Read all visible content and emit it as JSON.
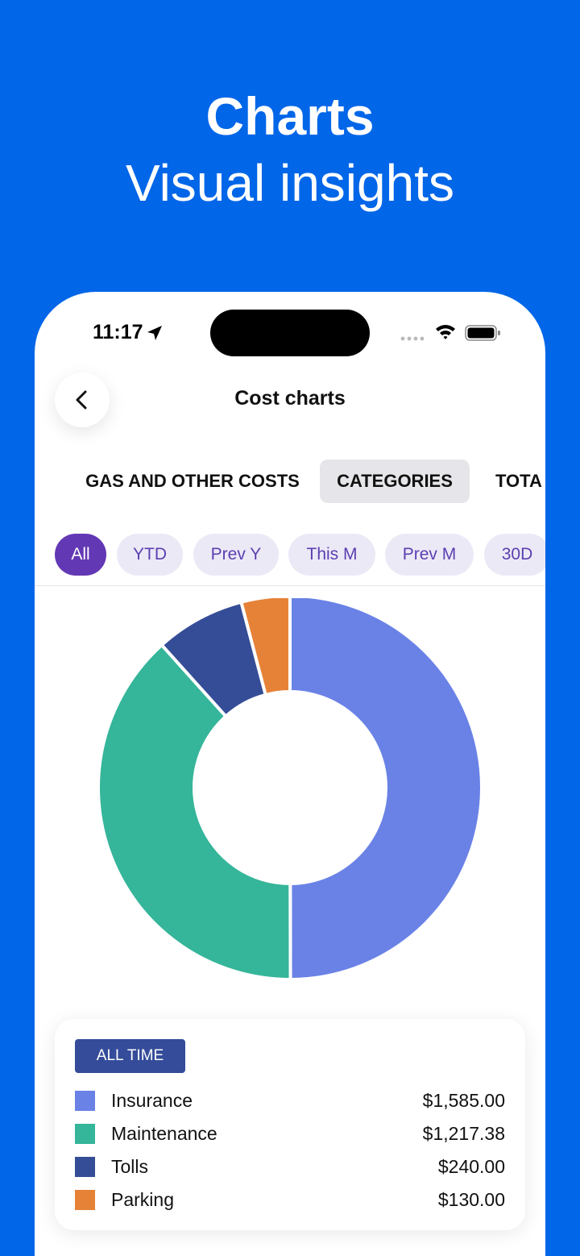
{
  "hero": {
    "title": "Charts",
    "subtitle": "Visual insights"
  },
  "status_bar": {
    "time": "11:17"
  },
  "nav": {
    "title": "Cost charts",
    "back_icon": "chevron-left-icon"
  },
  "tabs": [
    {
      "label": "GAS AND OTHER COSTS",
      "active": false
    },
    {
      "label": "CATEGORIES",
      "active": true
    },
    {
      "label": "TOTA",
      "active": false
    }
  ],
  "chips": [
    {
      "label": "All",
      "active": true
    },
    {
      "label": "YTD",
      "active": false
    },
    {
      "label": "Prev Y",
      "active": false
    },
    {
      "label": "This M",
      "active": false
    },
    {
      "label": "Prev M",
      "active": false
    },
    {
      "label": "30D",
      "active": false
    }
  ],
  "legend": {
    "period": "ALL TIME",
    "items": [
      {
        "label": "Insurance",
        "value": "$1,585.00"
      },
      {
        "label": "Maintenance",
        "value": "$1,217.38"
      },
      {
        "label": "Tolls",
        "value": "$240.00"
      },
      {
        "label": "Parking",
        "value": "$130.00"
      }
    ]
  },
  "chart_data": {
    "type": "pie",
    "title": "",
    "categories": [
      "Insurance",
      "Maintenance",
      "Tolls",
      "Parking"
    ],
    "values": [
      1585.0,
      1217.38,
      240.0,
      130.0
    ],
    "colors": [
      "#6a82e6",
      "#35b59a",
      "#354d97",
      "#e68237"
    ],
    "donut": true
  }
}
